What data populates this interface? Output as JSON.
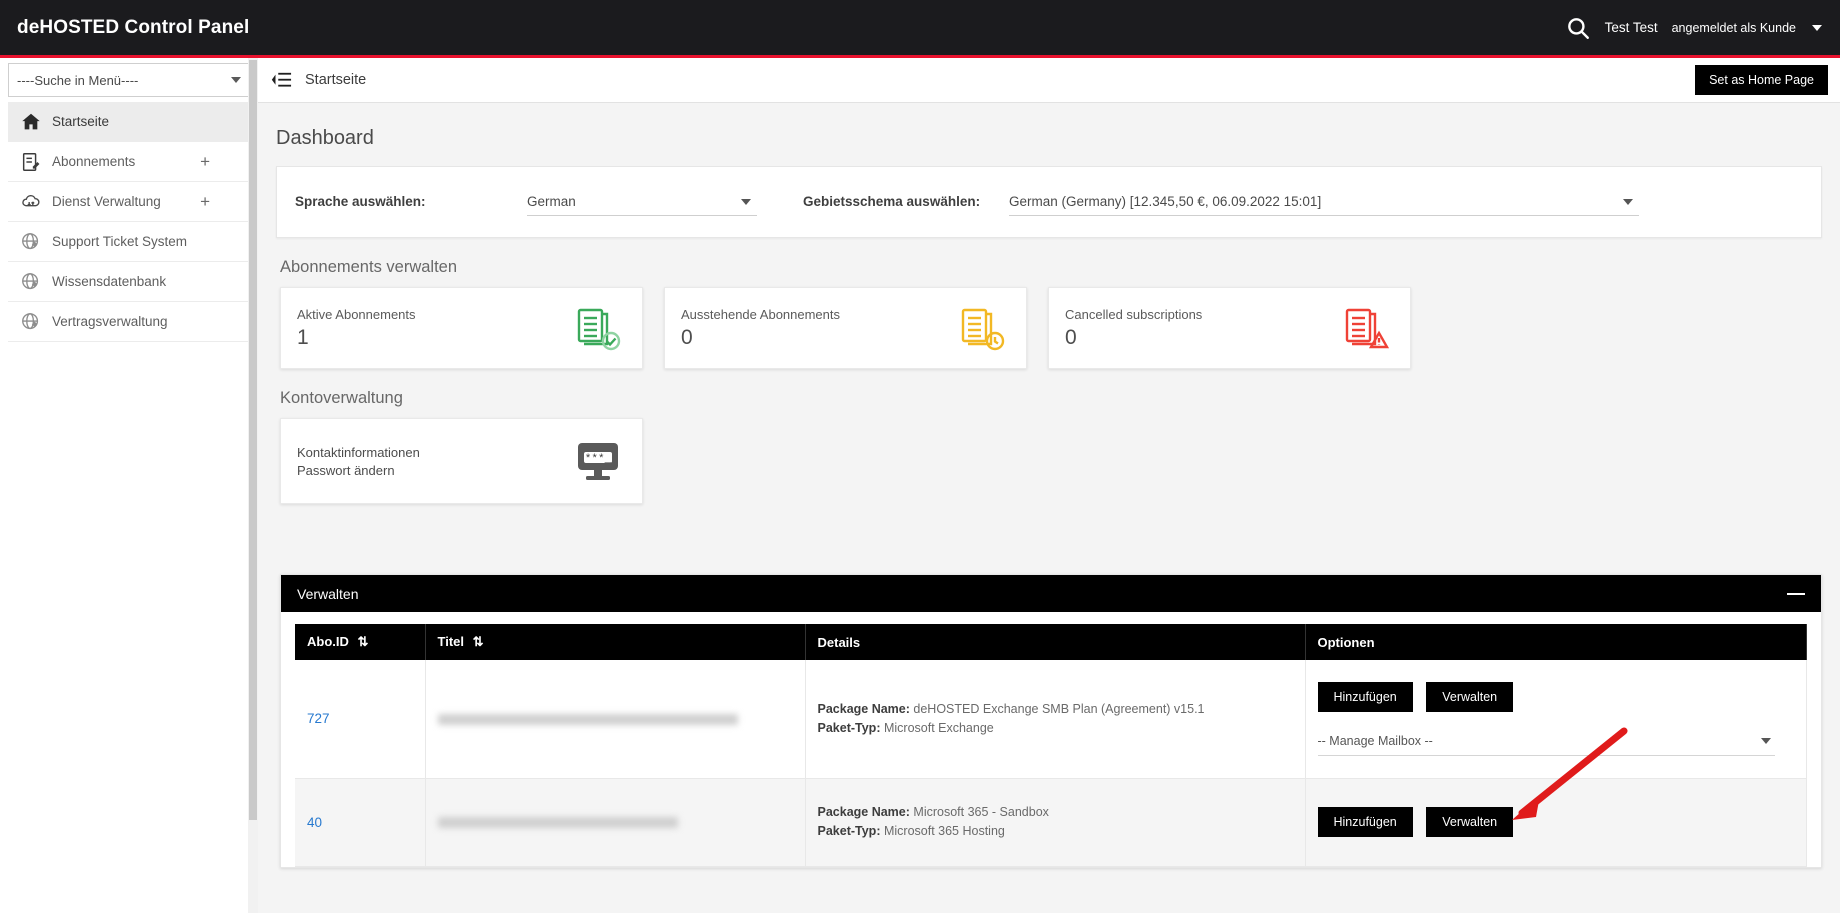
{
  "topbar": {
    "brand": "deHOSTED Control Panel",
    "search_icon": "search-icon",
    "user_name": "Test Test",
    "user_role": "angemeldet als Kunde"
  },
  "sidebar": {
    "search_placeholder": "----Suche in Menü----",
    "items": [
      {
        "label": "Startseite",
        "icon": "home-icon",
        "expandable": false,
        "active": true
      },
      {
        "label": "Abonnements",
        "icon": "document-edit-icon",
        "expandable": true,
        "active": false
      },
      {
        "label": "Dienst Verwaltung",
        "icon": "cloud-sync-icon",
        "expandable": true,
        "active": false
      },
      {
        "label": "Support Ticket System",
        "icon": "globe-link-icon",
        "expandable": false,
        "active": false
      },
      {
        "label": "Wissensdatenbank",
        "icon": "globe-link-icon",
        "expandable": false,
        "active": false
      },
      {
        "label": "Vertragsverwaltung",
        "icon": "globe-link-icon",
        "expandable": false,
        "active": false
      }
    ],
    "plus_symbol": "+"
  },
  "breadcrumb": {
    "collapse_icon": "collapse-menu-icon",
    "text": "Startseite",
    "home_button": "Set as Home Page"
  },
  "dashboard": {
    "title": "Dashboard",
    "language_label": "Sprache auswählen:",
    "language_value": "German",
    "locale_label": "Gebietsschema auswählen:",
    "locale_value": "German (Germany) [12.345,50 €, 06.09.2022 15:01]"
  },
  "subscriptions_section": {
    "heading": "Abonnements verwalten",
    "cards": [
      {
        "label": "Aktive Abonnements",
        "value": "1",
        "icon": "documents-check-icon",
        "color": "#3aa95a"
      },
      {
        "label": "Ausstehende Abonnements",
        "value": "0",
        "icon": "documents-clock-icon",
        "color": "#f2b824"
      },
      {
        "label": "Cancelled subscriptions",
        "value": "0",
        "icon": "documents-warning-icon",
        "color": "#ef4136"
      }
    ]
  },
  "account_section": {
    "heading": "Kontoverwaltung",
    "card": {
      "line1": "Kontaktinformationen",
      "line2": "Passwort ändern",
      "icon": "monitor-password-icon",
      "icon_text": "***_",
      "color": "#5a5a5a"
    }
  },
  "manage_panel": {
    "title": "Verwalten",
    "collapse_icon": "minus-icon",
    "columns": [
      {
        "label": "Abo.ID",
        "sortable": true,
        "sort_icon": "sort-updown-icon"
      },
      {
        "label": "Titel",
        "sortable": true,
        "sort_icon": "sort-updown-icon"
      },
      {
        "label": "Details",
        "sortable": false
      },
      {
        "label": "Optionen",
        "sortable": false
      }
    ],
    "rows": [
      {
        "id": "727",
        "title": "",
        "title_redacted": true,
        "package_name_label": "Package Name:",
        "package_name": "deHOSTED Exchange SMB Plan (Agreement) v15.1",
        "package_type_label": "Paket-Typ:",
        "package_type": "Microsoft Exchange",
        "add_button": "Hinzufügen",
        "manage_button": "Verwalten",
        "dropdown": "-- Manage Mailbox --",
        "has_dropdown": true
      },
      {
        "id": "40",
        "title": "",
        "title_redacted": true,
        "package_name_label": "Package Name:",
        "package_name": "Microsoft 365 - Sandbox",
        "package_type_label": "Paket-Typ:",
        "package_type": "Microsoft 365 Hosting",
        "add_button": "Hinzufügen",
        "manage_button": "Verwalten",
        "dropdown": "",
        "has_dropdown": false
      }
    ]
  },
  "annotation": {
    "type": "arrow",
    "color": "#e01b1b",
    "points_to": "Verwalten button in row 40"
  },
  "colors": {
    "accent_red": "#e8112d",
    "topbar": "#1b1b1e",
    "page_bg": "#f4f4f4",
    "link_blue": "#2779cf"
  }
}
